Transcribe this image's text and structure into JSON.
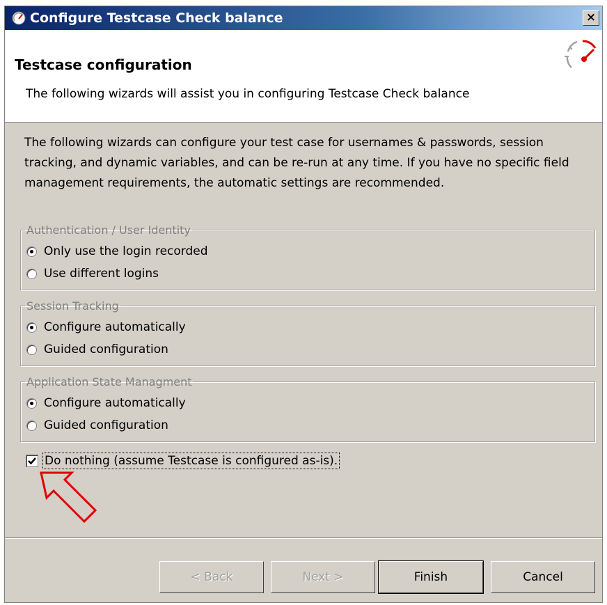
{
  "window": {
    "title": "Configure Testcase Check balance",
    "close_label": "×"
  },
  "banner": {
    "title": "Testcase configuration",
    "subtitle": "The following wizards will assist you in configuring Testcase Check balance"
  },
  "intro": "The following wizards can configure your test case for usernames & passwords, session tracking, and dynamic variables, and can be re-run at any time. If you have no specific field management requirements, the automatic settings are recommended.",
  "groups": [
    {
      "legend": "Authentication / User Identity",
      "options": [
        {
          "label": "Only use the login recorded",
          "checked": true
        },
        {
          "label": "Use different logins",
          "checked": false
        }
      ]
    },
    {
      "legend": "Session Tracking",
      "options": [
        {
          "label": "Configure automatically",
          "checked": true
        },
        {
          "label": "Guided configuration",
          "checked": false
        }
      ]
    },
    {
      "legend": "Application State Managment",
      "options": [
        {
          "label": "Configure automatically",
          "checked": true
        },
        {
          "label": "Guided configuration",
          "checked": false
        }
      ]
    }
  ],
  "do_nothing": {
    "label": "Do nothing (assume Testcase is configured as-is).",
    "checked": true
  },
  "buttons": {
    "back": "< Back",
    "next": "Next >",
    "finish": "Finish",
    "cancel": "Cancel"
  },
  "colors": {
    "annotation_arrow": "#e00000",
    "title_bar": "#0a246a"
  }
}
